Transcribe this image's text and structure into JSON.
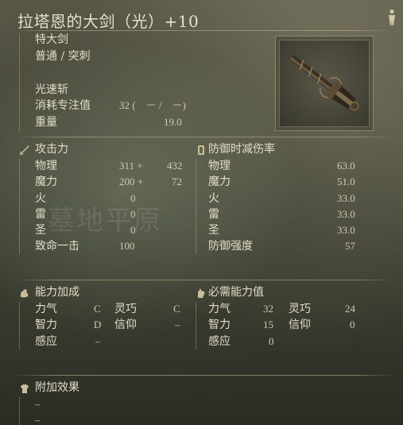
{
  "title": "拉塔恩的大剑（光）+10",
  "weapon_class": "特大剑",
  "damage_type": "普通 / 突刺",
  "skill": "光速斩",
  "fp": {
    "label": "消耗专注值",
    "value": "32 (　－ /　－)"
  },
  "weight": {
    "label": "重量",
    "value": "19.0"
  },
  "watermark": "墓地平原",
  "attack": {
    "header": "攻击力",
    "rows": [
      {
        "label": "物理",
        "base": "311 +",
        "bonus": "432"
      },
      {
        "label": "魔力",
        "base": "200 +",
        "bonus": "72"
      },
      {
        "label": "火",
        "base": "0",
        "bonus": ""
      },
      {
        "label": "雷",
        "base": "0",
        "bonus": ""
      },
      {
        "label": "圣",
        "base": "0",
        "bonus": ""
      },
      {
        "label": "致命一击",
        "base": "100",
        "bonus": ""
      }
    ]
  },
  "guard": {
    "header": "防御时减伤率",
    "rows": [
      {
        "label": "物理",
        "value": "63.0"
      },
      {
        "label": "魔力",
        "value": "51.0"
      },
      {
        "label": "火",
        "value": "33.0"
      },
      {
        "label": "雷",
        "value": "33.0"
      },
      {
        "label": "圣",
        "value": "33.0"
      },
      {
        "label": "防御强度",
        "value": "57"
      }
    ]
  },
  "scaling": {
    "header": "能力加成",
    "rows": [
      {
        "l1": "力气",
        "v1": "C",
        "l2": "灵巧",
        "v2": "C"
      },
      {
        "l1": "智力",
        "v1": "D",
        "l2": "信仰",
        "v2": "–"
      },
      {
        "l1": "感应",
        "v1": "–",
        "l2": "",
        "v2": ""
      }
    ]
  },
  "requirements": {
    "header": "必需能力值",
    "rows": [
      {
        "l1": "力气",
        "v1": "32",
        "l2": "灵巧",
        "v2": "24"
      },
      {
        "l1": "智力",
        "v1": "15",
        "l2": "信仰",
        "v2": "0"
      },
      {
        "l1": "感应",
        "v1": "0",
        "l2": "",
        "v2": ""
      }
    ]
  },
  "effects": {
    "header": "附加效果",
    "rows": [
      "–",
      "–"
    ]
  },
  "icons": {
    "person": "person-icon",
    "sword": "sword-icon",
    "shield": "shield-icon",
    "scaling": "strength-icon",
    "requirements": "hand-icon",
    "effects": "armor-icon"
  }
}
